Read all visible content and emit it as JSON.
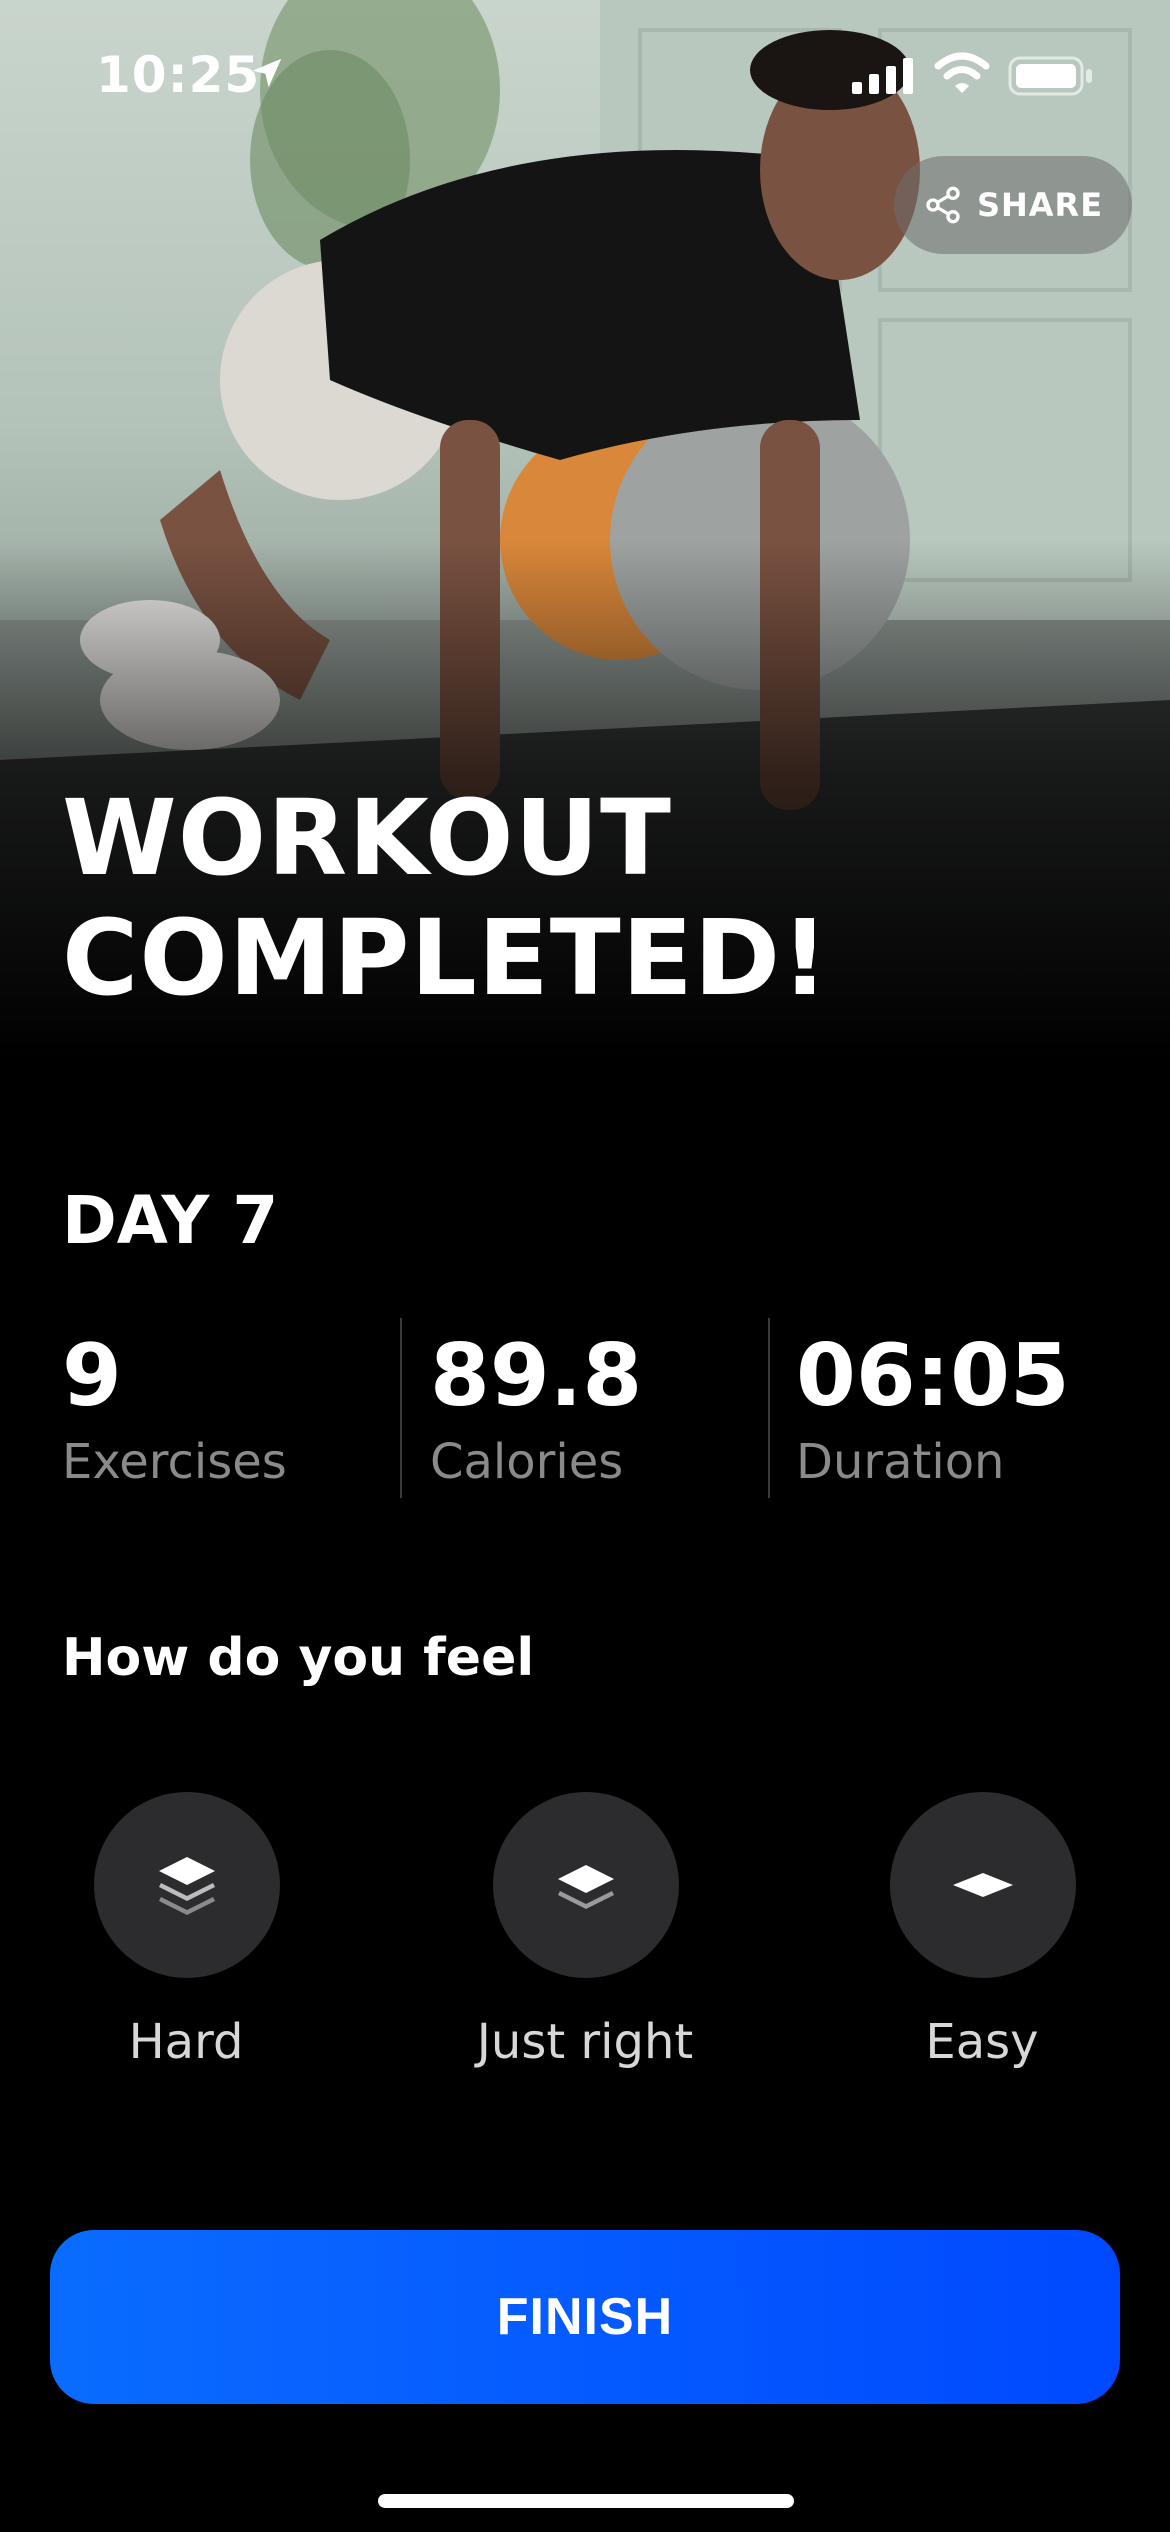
{
  "status_bar": {
    "time": "10:25",
    "icons": [
      "location-arrow-icon",
      "cellular-signal-icon",
      "wifi-icon",
      "battery-icon"
    ]
  },
  "share": {
    "label": "SHARE",
    "icon": "share-icon"
  },
  "title": {
    "line1": "WORKOUT",
    "line2": "COMPLETED!"
  },
  "day": "DAY 7",
  "stats": [
    {
      "value": "9",
      "label": "Exercises"
    },
    {
      "value": "89.8",
      "label": "Calories"
    },
    {
      "value": "06:05",
      "label": "Duration"
    }
  ],
  "feel": {
    "heading": "How do you feel",
    "options": [
      {
        "label": "Hard",
        "icon": "layers-three-icon"
      },
      {
        "label": "Just right",
        "icon": "layers-two-icon"
      },
      {
        "label": "Easy",
        "icon": "layers-one-icon"
      }
    ]
  },
  "finish": {
    "label": "FINISH"
  },
  "colors": {
    "background": "#000000",
    "accent": "#0a6cff",
    "stat_label": "#8a8a8a",
    "option_circle": "#2c2c2e"
  }
}
